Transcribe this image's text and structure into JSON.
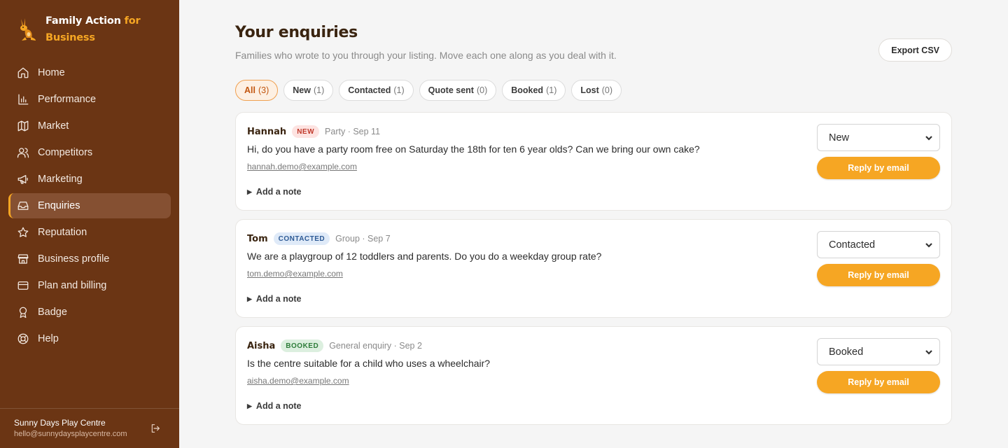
{
  "brand": {
    "name_line1": "Family Action",
    "name_accent1": "for",
    "name_accent2": "Business"
  },
  "nav": [
    {
      "label": "Home",
      "icon": "home-icon"
    },
    {
      "label": "Performance",
      "icon": "bar-chart-icon"
    },
    {
      "label": "Market",
      "icon": "map-icon"
    },
    {
      "label": "Competitors",
      "icon": "users-icon"
    },
    {
      "label": "Marketing",
      "icon": "megaphone-icon"
    },
    {
      "label": "Enquiries",
      "icon": "inbox-icon",
      "active": true
    },
    {
      "label": "Reputation",
      "icon": "star-icon"
    },
    {
      "label": "Business profile",
      "icon": "store-icon"
    },
    {
      "label": "Plan and billing",
      "icon": "credit-card-icon"
    },
    {
      "label": "Badge",
      "icon": "award-icon"
    },
    {
      "label": "Help",
      "icon": "lifebuoy-icon"
    }
  ],
  "account": {
    "name": "Sunny Days Play Centre",
    "email": "hello@sunnydaysplaycentre.com"
  },
  "page": {
    "title": "Your enquiries",
    "subtitle": "Families who wrote to you through your listing. Move each one along as you deal with it.",
    "export_label": "Export CSV"
  },
  "filters": [
    {
      "label": "All",
      "count": "(3)",
      "active": true
    },
    {
      "label": "New",
      "count": "(1)"
    },
    {
      "label": "Contacted",
      "count": "(1)"
    },
    {
      "label": "Quote sent",
      "count": "(0)"
    },
    {
      "label": "Booked",
      "count": "(1)"
    },
    {
      "label": "Lost",
      "count": "(0)"
    }
  ],
  "enquiries": [
    {
      "name": "Hannah",
      "badge": "NEW",
      "meta": "Party · Sep 11",
      "message": "Hi, do you have a party room free on Saturday the 18th for ten 6 year olds? Can we bring our own cake?",
      "email": "hannah.demo@example.com",
      "note_label": "Add a note",
      "status": "New",
      "reply_label": "Reply by email"
    },
    {
      "name": "Tom",
      "badge": "CONTACTED",
      "meta": "Group · Sep 7",
      "message": "We are a playgroup of 12 toddlers and parents. Do you do a weekday group rate?",
      "email": "tom.demo@example.com",
      "note_label": "Add a note",
      "status": "Contacted",
      "reply_label": "Reply by email"
    },
    {
      "name": "Aisha",
      "badge": "BOOKED",
      "meta": "General enquiry · Sep 2",
      "message": "Is the centre suitable for a child who uses a wheelchair?",
      "email": "aisha.demo@example.com",
      "note_label": "Add a note",
      "status": "Booked",
      "reply_label": "Reply by email"
    }
  ],
  "colors": {
    "sidebar": "#6b3514",
    "accent": "#f6a623",
    "title": "#3a2410"
  }
}
